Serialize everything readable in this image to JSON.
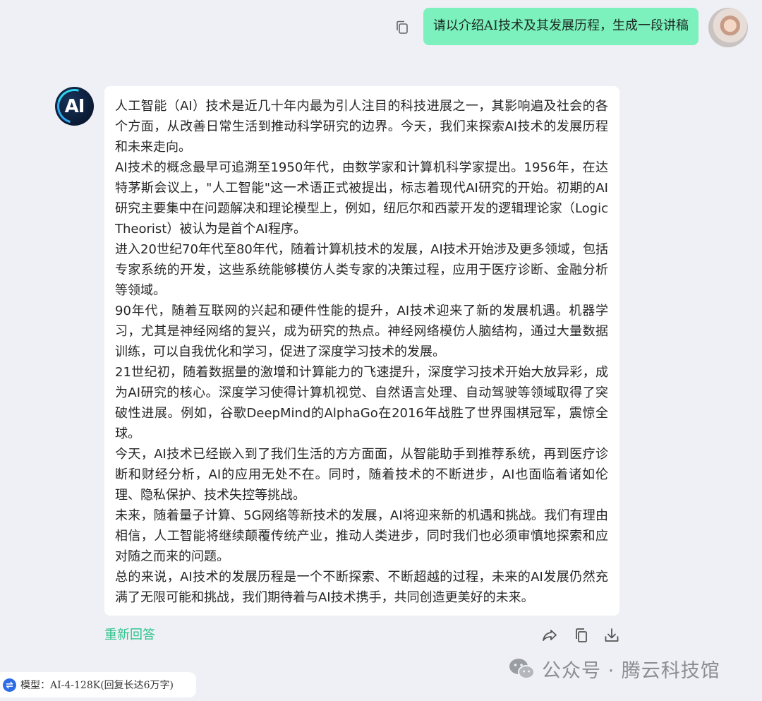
{
  "user_message": {
    "text": "请以介绍AI技术及其发展历程，生成一段讲稿",
    "avatar_icon": "user-avatar-photo",
    "copy_icon": "copy-icon",
    "bubble_color": "#7cf0bd"
  },
  "assistant": {
    "avatar_text": "AI",
    "paragraphs": [
      "人工智能（AI）技术是近几十年内最为引人注目的科技进展之一，其影响遍及社会的各个方面，从改善日常生活到推动科学研究的边界。今天，我们来探索AI技术的发展历程和未来走向。",
      "AI技术的概念最早可追溯至1950年代，由数学家和计算机科学家提出。1956年，在达特茅斯会议上，\"人工智能\"这一术语正式被提出，标志着现代AI研究的开始。初期的AI研究主要集中在问题解决和理论模型上，例如，纽厄尔和西蒙开发的逻辑理论家（Logic Theorist）被认为是首个AI程序。",
      "进入20世纪70年代至80年代，随着计算机技术的发展，AI技术开始涉及更多领域，包括专家系统的开发，这些系统能够模仿人类专家的决策过程，应用于医疗诊断、金融分析等领域。",
      "90年代，随着互联网的兴起和硬件性能的提升，AI技术迎来了新的发展机遇。机器学习，尤其是神经网络的复兴，成为研究的热点。神经网络模仿人脑结构，通过大量数据训练，可以自我优化和学习，促进了深度学习技术的发展。",
      "21世纪初，随着数据量的激增和计算能力的飞速提升，深度学习技术开始大放异彩，成为AI研究的核心。深度学习使得计算机视觉、自然语言处理、自动驾驶等领域取得了突破性进展。例如，谷歌DeepMind的AlphaGo在2016年战胜了世界围棋冠军，震惊全球。",
      "今天，AI技术已经嵌入到了我们生活的方方面面，从智能助手到推荐系统，再到医疗诊断和财经分析，AI的应用无处不在。同时，随着技术的不断进步，AI也面临着诸如伦理、隐私保护、技术失控等挑战。",
      "未来，随着量子计算、5G网络等新技术的发展，AI将迎来新的机遇和挑战。我们有理由相信，人工智能将继续颠覆传统产业，推动人类进步，同时我们也必须审慎地探索和应对随之而来的问题。",
      "总的来说，AI技术的发展历程是一个不断探索、不断超越的过程，未来的AI发展仍然充满了无限可能和挑战，我们期待着与AI技术携手，共同创造更美好的未来。"
    ]
  },
  "actions": {
    "regenerate_label": "重新回答",
    "regenerate_color": "#2cc28b",
    "icons": [
      "share-icon",
      "copy-icon",
      "download-icon"
    ]
  },
  "model_selector": {
    "label": "模型：AI-4-128K(回复长达6万字)",
    "icon": "swap-icon"
  },
  "watermark": {
    "text": "公众号 · 腾云科技馆",
    "icon": "wechat-icon"
  }
}
